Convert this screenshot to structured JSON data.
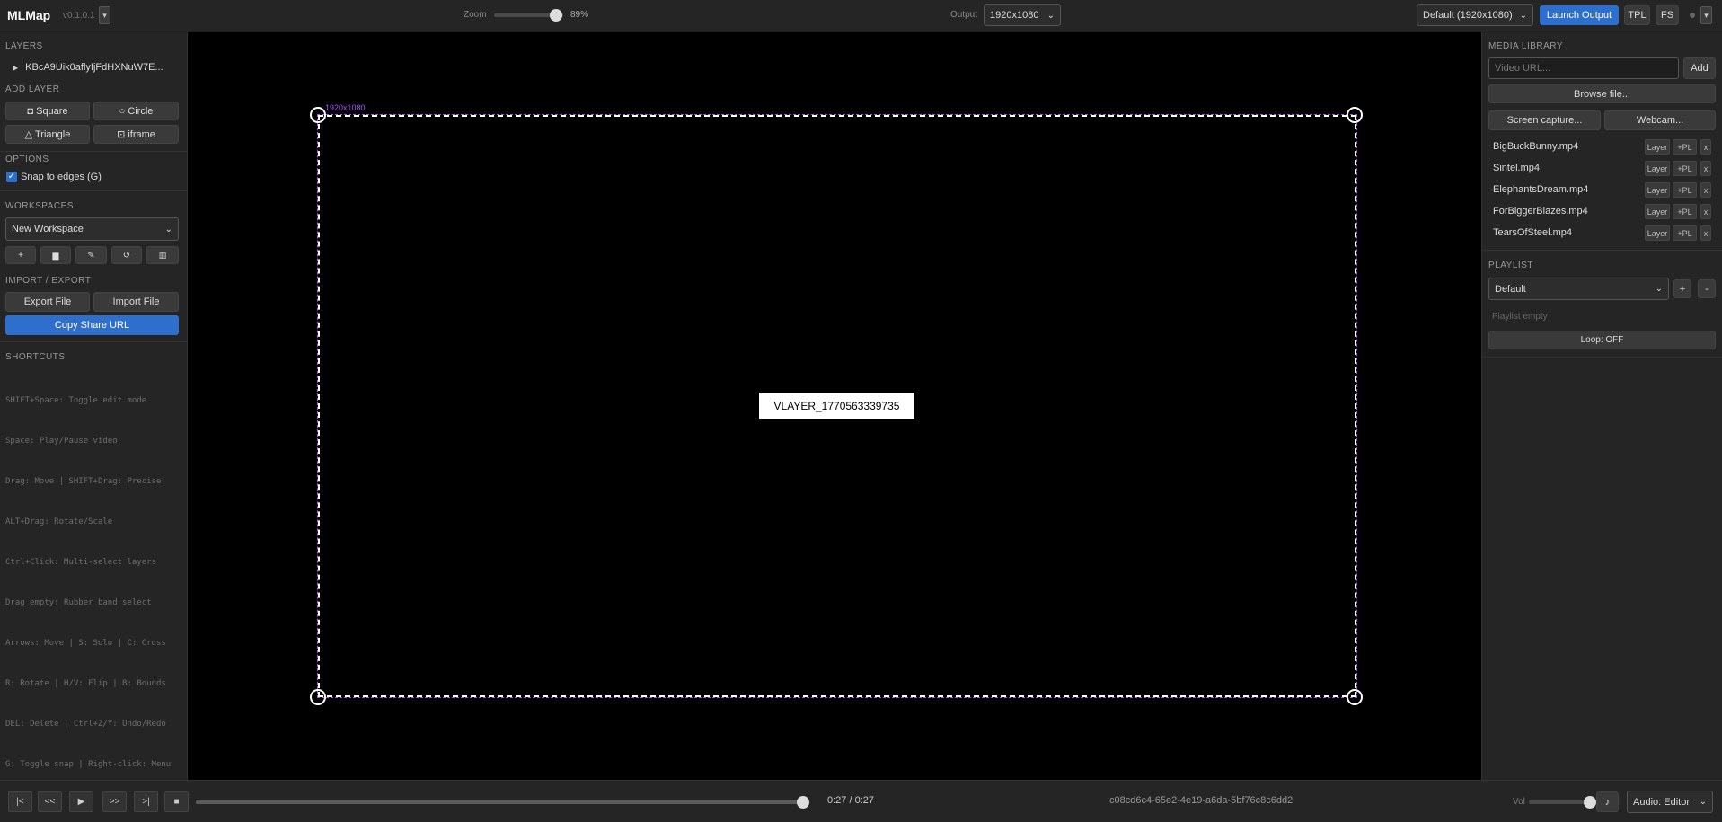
{
  "topbar": {
    "brand": "MLMap",
    "version": "v0.1.0.1",
    "menu_label": "▾",
    "zoom_label": "Zoom",
    "zoom_value": "89%",
    "zoom_level": 0.89,
    "output_label": "Output",
    "output_resolution": "1920x1080",
    "preset": "Default (1920x1080)",
    "launch_label": "Launch Output",
    "tpl_label": "TPL",
    "fs_label": "FS",
    "more_label": "▾"
  },
  "left": {
    "layers_title": "LAYERS",
    "layer_name": "KBcA9Uik0aflyIjFdHXNuW7E...",
    "add_layer_title": "ADD LAYER",
    "square_label": "◘ Square",
    "circle_label": "○ Circle",
    "triangle_label": "△ Triangle",
    "iframe_label": "⊡ iframe",
    "options_title": "OPTIONS",
    "snap_label": "Snap to edges (G)",
    "snap_checked": true,
    "workspaces_title": "WORKSPACES",
    "workspace_selected": "New Workspace",
    "ws_add": "+",
    "ws_save": "▆",
    "ws_rename": "✎",
    "ws_reload": "↺",
    "ws_delete": "▥",
    "import_export_title": "IMPORT / EXPORT",
    "export_label": "Export File",
    "import_label": "Import File",
    "share_label": "Copy Share URL",
    "shortcuts_title": "SHORTCUTS",
    "shortcuts": [
      "SHIFT+Space: Toggle edit mode",
      "Space: Play/Pause video",
      "Drag: Move | SHIFT+Drag: Precise",
      "ALT+Drag: Rotate/Scale",
      "Ctrl+Click: Multi-select layers",
      "Drag empty: Rubber band select",
      "Arrows: Move | S: Solo | C: Cross",
      "R: Rotate | H/V: Flip | B: Bounds",
      "DEL: Delete | Ctrl+Z/Y: Undo/Redo",
      "G: Toggle snap | Right-click: Menu"
    ]
  },
  "canvas": {
    "stage_label": "1920x1080",
    "layer_label": "VLAYER_1770563339735"
  },
  "right": {
    "media_title": "MEDIA LIBRARY",
    "url_placeholder": "Video URL...",
    "add_label": "Add",
    "browse_label": "Browse file...",
    "screen_label": "Screen capture...",
    "webcam_label": "Webcam...",
    "media": [
      {
        "name": "BigBuckBunny.mp4"
      },
      {
        "name": "Sintel.mp4"
      },
      {
        "name": "ElephantsDream.mp4"
      },
      {
        "name": "ForBiggerBlazes.mp4"
      },
      {
        "name": "TearsOfSteel.mp4"
      }
    ],
    "media_layer_label": "Layer",
    "media_pl_label": "+PL",
    "media_remove_label": "x",
    "playlist_title": "PLAYLIST",
    "playlist_selected": "Default",
    "playlist_add": "+",
    "playlist_remove": "-",
    "playlist_empty": "Playlist empty",
    "loop_label": "Loop: OFF"
  },
  "bottom": {
    "first": "|<",
    "prev": "<<",
    "play": "▶",
    "next": ">>",
    "last": ">|",
    "stop": "■",
    "progress": 1.0,
    "time": "0:27 / 0:27",
    "uuid": "c08cd6c4-65e2-4e19-a6da-5bf76c8c6dd2",
    "vol_label": "Vol",
    "volume": 1.0,
    "audio_icon_label": "♪",
    "audio_mode": "Audio: Editor"
  },
  "colors": {
    "accent": "#2e6fce",
    "stage_outline": "#a855f7"
  }
}
